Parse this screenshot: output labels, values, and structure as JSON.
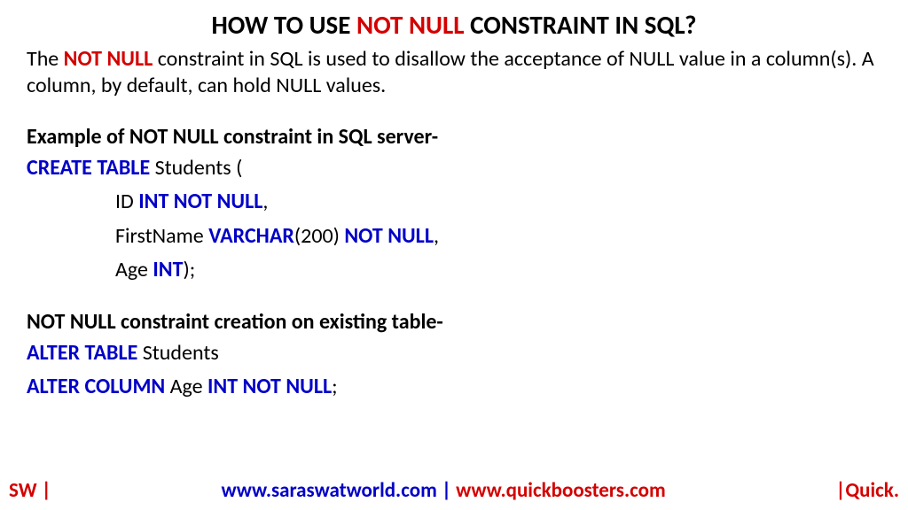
{
  "title": {
    "prefix": "HOW TO USE ",
    "highlight": "NOT NULL",
    "suffix": " CONSTRAINT IN SQL?"
  },
  "desc": {
    "p1": "The ",
    "highlight": "NOT NULL",
    "p2": " constraint in SQL is used to disallow the acceptance of NULL value in a column(s). A column, by default, can hold NULL values."
  },
  "section1": {
    "heading": "Example of NOT NULL constraint in SQL server-",
    "line1": {
      "kw": "CREATE TABLE",
      "rest": " Students ("
    },
    "line2": {
      "pre": "ID ",
      "kw": "INT NOT NULL",
      "post": ","
    },
    "line3": {
      "pre": "FirstName ",
      "kw1": "VARCHAR",
      "mid": "(200) ",
      "kw2": "NOT NULL",
      "post": ","
    },
    "line4": {
      "pre": "Age ",
      "kw": "INT",
      "post": ");"
    }
  },
  "section2": {
    "heading": "NOT NULL constraint creation on existing table-",
    "line1": {
      "kw": "ALTER TABLE",
      "rest": " Students"
    },
    "line2": {
      "kw1": "ALTER COLUMN",
      "mid": " Age ",
      "kw2": "INT NOT NULL",
      "post": ";"
    }
  },
  "footer": {
    "left": "SW |",
    "center1": "www.saraswatworld.com | ",
    "center2": "www.quickboosters.com",
    "right": "|Quick."
  }
}
